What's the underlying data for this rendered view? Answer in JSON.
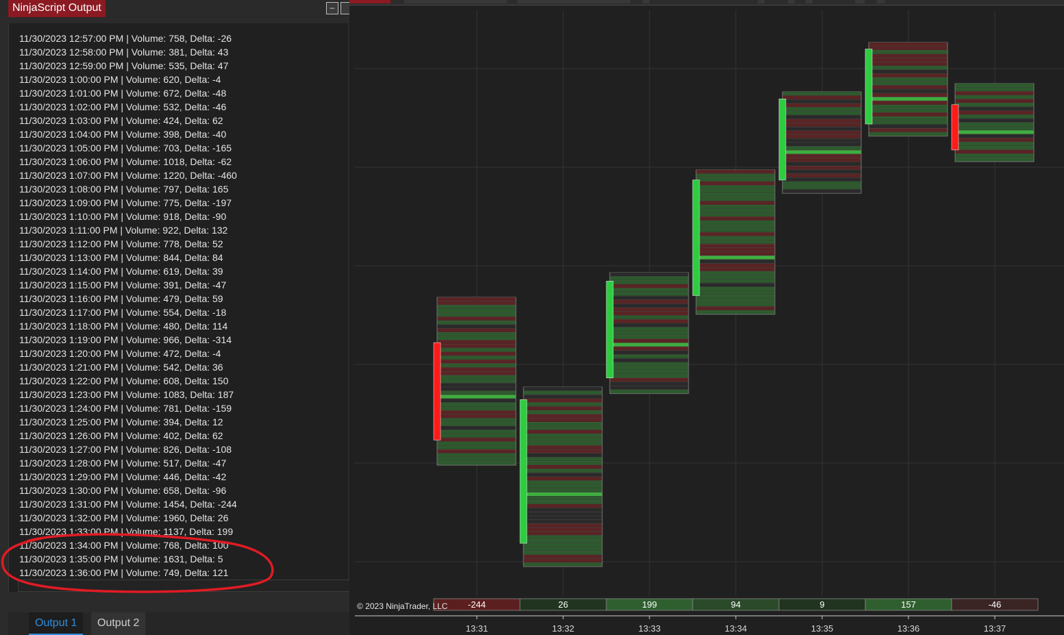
{
  "output_window": {
    "title": "NinjaScript Output",
    "buttons": {
      "minimize": "–"
    },
    "lines": [
      "11/30/2023 12:57:00 PM | Volume: 758, Delta: -26",
      "11/30/2023 12:58:00 PM | Volume: 381, Delta: 43",
      "11/30/2023 12:59:00 PM | Volume: 535, Delta: 47",
      "11/30/2023 1:00:00 PM | Volume: 620, Delta: -4",
      "11/30/2023 1:01:00 PM | Volume: 672, Delta: -48",
      "11/30/2023 1:02:00 PM | Volume: 532, Delta: -46",
      "11/30/2023 1:03:00 PM | Volume: 424, Delta: 62",
      "11/30/2023 1:04:00 PM | Volume: 398, Delta: -40",
      "11/30/2023 1:05:00 PM | Volume: 703, Delta: -165",
      "11/30/2023 1:06:00 PM | Volume: 1018, Delta: -62",
      "11/30/2023 1:07:00 PM | Volume: 1220, Delta: -460",
      "11/30/2023 1:08:00 PM | Volume: 797, Delta: 165",
      "11/30/2023 1:09:00 PM | Volume: 775, Delta: -197",
      "11/30/2023 1:10:00 PM | Volume: 918, Delta: -90",
      "11/30/2023 1:11:00 PM | Volume: 922, Delta: 132",
      "11/30/2023 1:12:00 PM | Volume: 778, Delta: 52",
      "11/30/2023 1:13:00 PM | Volume: 844, Delta: 84",
      "11/30/2023 1:14:00 PM | Volume: 619, Delta: 39",
      "11/30/2023 1:15:00 PM | Volume: 391, Delta: -47",
      "11/30/2023 1:16:00 PM | Volume: 479, Delta: 59",
      "11/30/2023 1:17:00 PM | Volume: 554, Delta: -18",
      "11/30/2023 1:18:00 PM | Volume: 480, Delta: 114",
      "11/30/2023 1:19:00 PM | Volume: 966, Delta: -314",
      "11/30/2023 1:20:00 PM | Volume: 472, Delta: -4",
      "11/30/2023 1:21:00 PM | Volume: 542, Delta: 36",
      "11/30/2023 1:22:00 PM | Volume: 608, Delta: 150",
      "11/30/2023 1:23:00 PM | Volume: 1083, Delta: 187",
      "11/30/2023 1:24:00 PM | Volume: 781, Delta: -159",
      "11/30/2023 1:25:00 PM | Volume: 394, Delta: 12",
      "11/30/2023 1:26:00 PM | Volume: 402, Delta: 62",
      "11/30/2023 1:27:00 PM | Volume: 826, Delta: -108",
      "11/30/2023 1:28:00 PM | Volume: 517, Delta: -47",
      "11/30/2023 1:29:00 PM | Volume: 446, Delta: -42",
      "11/30/2023 1:30:00 PM | Volume: 658, Delta: -96",
      "11/30/2023 1:31:00 PM | Volume: 1454, Delta: -244",
      "11/30/2023 1:32:00 PM | Volume: 1960, Delta: 26",
      "11/30/2023 1:33:00 PM | Volume: 1137, Delta: 199",
      "11/30/2023 1:34:00 PM | Volume: 768, Delta: 100",
      "11/30/2023 1:35:00 PM | Volume: 1631, Delta: 5",
      "11/30/2023 1:36:00 PM | Volume: 749, Delta: 121"
    ],
    "tabs": [
      "Output 1",
      "Output 2"
    ],
    "active_tab": "Output 1",
    "annotation_color": "#e01b24"
  },
  "chart": {
    "copyright": "© 2023 NinjaTrader, LLC",
    "time_labels": [
      "13:31",
      "13:32",
      "13:33",
      "13:34",
      "13:35",
      "13:36",
      "13:37"
    ],
    "delta_values": [
      -244,
      26,
      199,
      94,
      9,
      157,
      -46
    ],
    "colors": {
      "background": "#202020",
      "grid": "#333333",
      "bull_candle": "#2ecc40",
      "bear_candle": "#ff1a1a",
      "cell_green": "#2d5a2d",
      "cell_red": "#5a2424",
      "cell_dark": "#2a2a2a",
      "poc": "#3fae3f",
      "text": "#ffffff",
      "highlight_text": "#ffd700"
    },
    "bars": [
      {
        "time": "13:31",
        "direction": "down",
        "rows": 43
      },
      {
        "time": "13:32",
        "direction": "up",
        "rows": 46
      },
      {
        "time": "13:33",
        "direction": "up",
        "rows": 31
      },
      {
        "time": "13:34",
        "direction": "up",
        "rows": 37
      },
      {
        "time": "13:35",
        "direction": "up",
        "rows": 26
      },
      {
        "time": "13:36",
        "direction": "up",
        "rows": 24
      },
      {
        "time": "13:37",
        "direction": "down",
        "rows": 20
      }
    ]
  }
}
